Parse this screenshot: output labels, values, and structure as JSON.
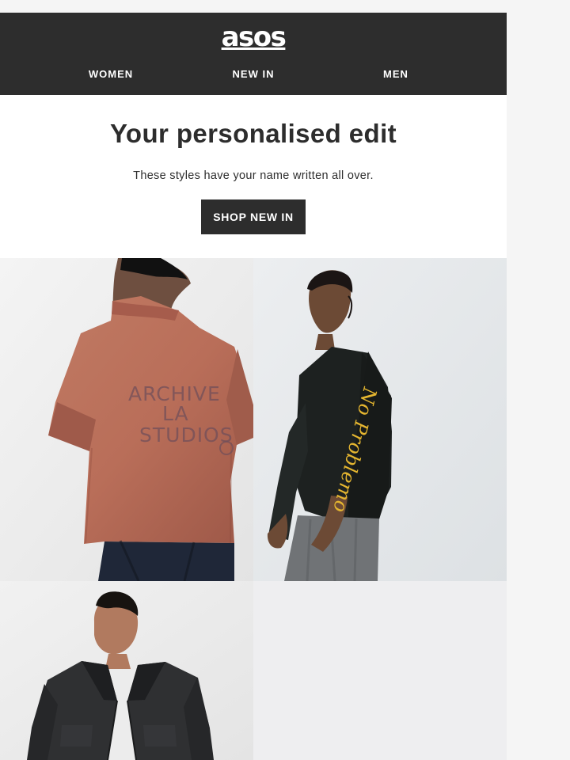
{
  "brand": {
    "logo_text": "asos"
  },
  "navigation": {
    "items": [
      {
        "label": "WOMEN"
      },
      {
        "label": "NEW IN"
      },
      {
        "label": "MEN"
      }
    ]
  },
  "hero": {
    "title": "Your personalised edit",
    "subtitle": "These styles have your name written all over.",
    "button_label": "SHOP NEW IN"
  },
  "products": {
    "tiles": [
      {
        "print_lines": [
          "ARCHIVE",
          "LA",
          "STUDIOS"
        ]
      },
      {
        "print_text": "No Problemo"
      },
      {},
      {}
    ]
  },
  "colors": {
    "page_bg": "#f5f5f5",
    "header_bg": "#2d2d2d",
    "button_bg": "#2d2d2d",
    "primary_text": "#2d2d2d",
    "inverse_text": "#ffffff",
    "rust_shirt": "#b96e59",
    "black_sweater": "#1d2120",
    "mustard_print": "#e5b630",
    "denim": "#1f2738",
    "charcoal_jacket": "#2f3032"
  }
}
